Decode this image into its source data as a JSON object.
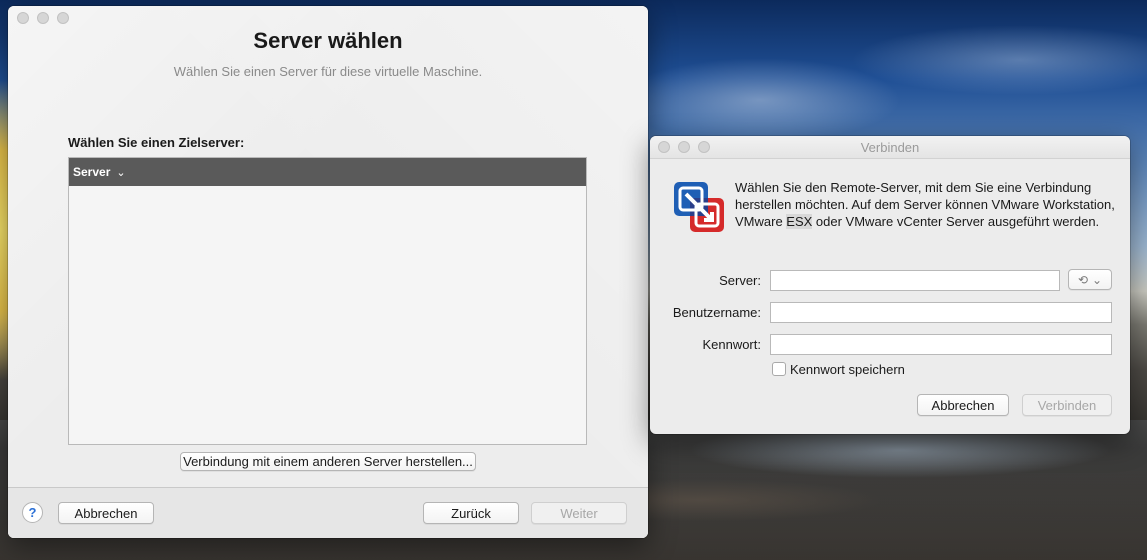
{
  "main_window": {
    "title": "Server wählen",
    "subtitle": "Wählen Sie einen Server für diese virtuelle Maschine.",
    "target_label": "Wählen Sie einen Zielserver:",
    "table": {
      "columns": [
        "Server"
      ],
      "rows": []
    },
    "connect_other_label": "Verbindung mit einem anderen Server herstellen...",
    "footer": {
      "help_label": "?",
      "cancel_label": "Abbrechen",
      "back_label": "Zurück",
      "next_label": "Weiter"
    }
  },
  "dialog": {
    "title": "Verbinden",
    "message_part1": "Wählen Sie den Remote-Server, mit dem Sie eine Verbindung herstellen möchten. Auf dem Server können VMware Workstation, VMware ",
    "message_highlight": "ESX",
    "message_part2": " oder VMware vCenter Server ausgeführt werden.",
    "fields": {
      "server_label": "Server:",
      "server_value": "",
      "username_label": "Benutzername:",
      "username_value": "",
      "password_label": "Kennwort:",
      "password_value": ""
    },
    "save_password_label": "Kennwort speichern",
    "save_password_checked": false,
    "cancel_label": "Abbrechen",
    "connect_label": "Verbinden",
    "icons": {
      "history": "history-icon",
      "chevron": "chevron-down-icon",
      "logo": "vmware-fusion-logo"
    }
  },
  "colors": {
    "table_header_bg": "#5a5a5a",
    "help_blue": "#2a6fd6",
    "logo_blue": "#1f5fb5",
    "logo_red": "#d52a2a"
  }
}
